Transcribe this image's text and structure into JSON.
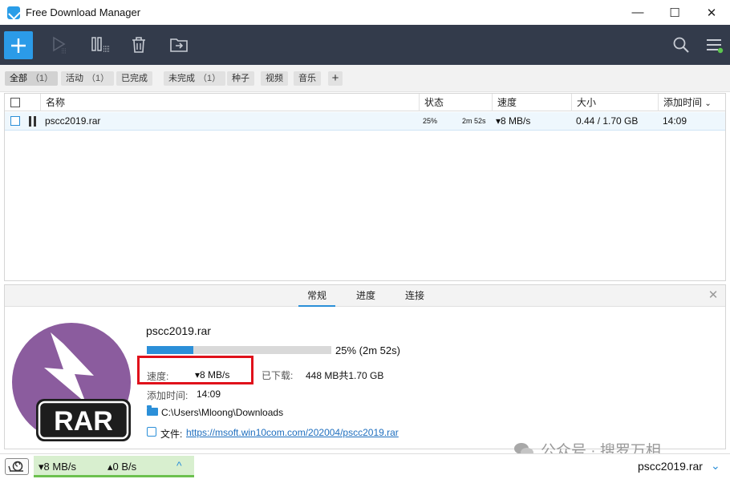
{
  "window": {
    "title": "Free Download Manager",
    "controls": {
      "minimize": "—",
      "maximize": "☐",
      "close": "✕"
    }
  },
  "toolbar": {
    "icons": [
      "add-icon",
      "play-icon",
      "pause-all-icon",
      "delete-icon",
      "move-icon",
      "search-icon",
      "menu-icon"
    ],
    "accent": "#2b9be8",
    "background": "#333b4b"
  },
  "filters": [
    {
      "label": "全部",
      "count": "（1）",
      "active": true
    },
    {
      "label": "活动",
      "count": "（1）",
      "active": false
    },
    {
      "label": "已完成",
      "count": "",
      "active": false
    },
    {
      "label": "未完成",
      "count": "（1）",
      "active": false
    },
    {
      "label": "种子",
      "count": "",
      "active": false
    },
    {
      "label": "视频",
      "count": "",
      "active": false
    },
    {
      "label": "音乐",
      "count": "",
      "active": false
    }
  ],
  "table": {
    "columns": {
      "name": "名称",
      "status": "状态",
      "speed": "速度",
      "size": "大小",
      "added": "添加时间",
      "sort_indicator": "⌄"
    },
    "rows": [
      {
        "name": "pscc2019.rar",
        "status_pct": "25%",
        "status_eta": "2m 52s",
        "speed": "▾8 MB/s",
        "size": "0.44 / 1.70 GB",
        "added": "14:09"
      }
    ]
  },
  "details": {
    "tabs": [
      "常规",
      "进度",
      "连接"
    ],
    "active_tab": 0,
    "close": "✕",
    "file_name": "pscc2019.rar",
    "progress": 0.25,
    "progress_text": "25% (2m 52s)",
    "speed_label": "速度:",
    "speed_value": "▾8 MB/s",
    "downloaded_label": "已下载:",
    "downloaded_value": "448 MB共1.70 GB",
    "added_label": "添加时间:",
    "added_value": "14:09",
    "folder": "C:\\Users\\Mloong\\Downloads",
    "file_label": "文件:",
    "file_url": "https://msoft.win10com.com/202004/pscc2019.rar",
    "logo_text": "RAR",
    "logo_color": "#8b5c9e"
  },
  "watermark": "公众号 · 搜罗万相",
  "statusbar": {
    "down_speed": "▾8 MB/s",
    "up_speed": "▴0 B/s",
    "chevron": "^",
    "current_file": "pscc2019.rar",
    "chevron2": "⌄"
  }
}
